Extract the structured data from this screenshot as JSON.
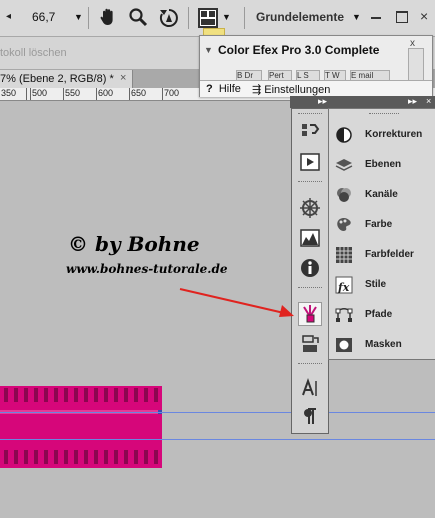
{
  "toolbar": {
    "zoom_value": "66,7",
    "workspace_label": "Grundelemente",
    "close_glyph": "×"
  },
  "optionsbar": {
    "history_label": "tokoll löschen"
  },
  "document": {
    "tab_label": "7% (Ebene 2, RGB/8) *",
    "tab_close": "×"
  },
  "ruler": {
    "labels": [
      "350",
      "500",
      "550",
      "600",
      "650",
      "700"
    ]
  },
  "canvas": {
    "watermark_title": "© by Bohne",
    "watermark_url": "www.bohnes-tutorale.de",
    "shape_color": "#d6067a",
    "guide_color": "#6a87e0"
  },
  "color_efex": {
    "title": "Color Efex Pro 3.0 Complete",
    "subtabs": [
      "B Dr",
      "Pert",
      "L S",
      "T W",
      "E mail"
    ],
    "help_label": "Hilfe",
    "settings_label": "Einstellungen",
    "close_glyph": "x"
  },
  "panels": {
    "items": [
      {
        "label": "Korrekturen",
        "icon": "adjustments-icon"
      },
      {
        "label": "Ebenen",
        "icon": "layers-icon"
      },
      {
        "label": "Kanäle",
        "icon": "channels-icon"
      },
      {
        "label": "Farbe",
        "icon": "color-icon"
      },
      {
        "label": "Farbfelder",
        "icon": "swatches-icon"
      },
      {
        "label": "Stile",
        "icon": "styles-icon"
      },
      {
        "label": "Pfade",
        "icon": "paths-icon"
      },
      {
        "label": "Masken",
        "icon": "masks-icon"
      }
    ]
  },
  "colors": {
    "accent_red": "#e0231f"
  }
}
